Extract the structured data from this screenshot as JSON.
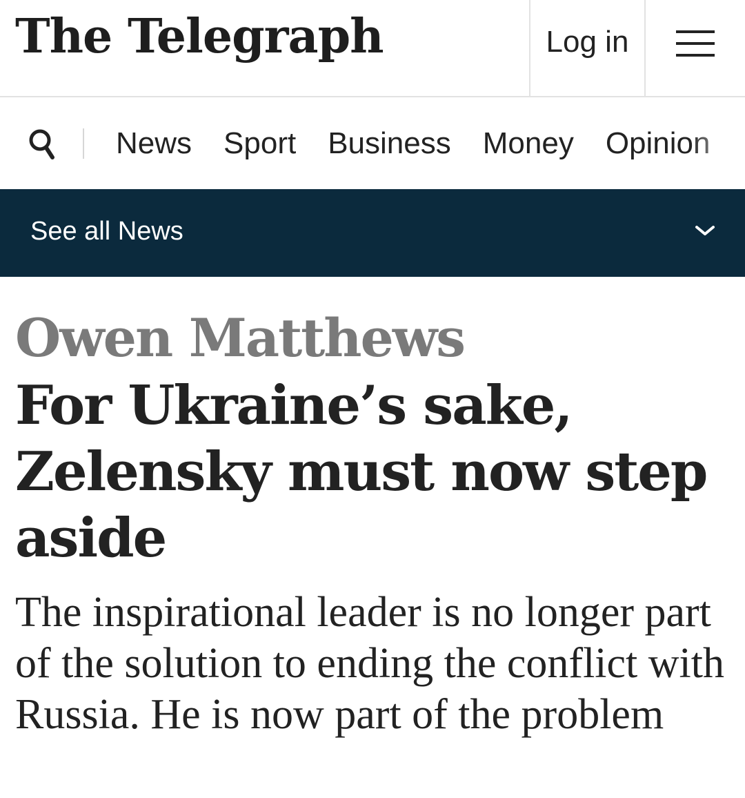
{
  "header": {
    "logo": "The Telegraph",
    "login_label": "Log in",
    "menu_icon": "hamburger-menu-icon"
  },
  "nav": {
    "search_icon": "search-icon",
    "items": [
      "News",
      "Sport",
      "Business",
      "Money",
      "Opinion"
    ]
  },
  "section_bar": {
    "label": "See all News",
    "chevron_icon": "chevron-down-icon",
    "background_color": "#0b2a3d"
  },
  "article": {
    "author": "Owen Matthews",
    "headline": "For Ukraine’s sake, Zelensky must now step aside",
    "standfirst": "The inspirational leader is no longer part of the solution to ending the conflict with Russia. He is now part of the problem"
  },
  "colors": {
    "author": "#7a7a7a",
    "text": "#222222",
    "divider": "#e2e2e2"
  }
}
